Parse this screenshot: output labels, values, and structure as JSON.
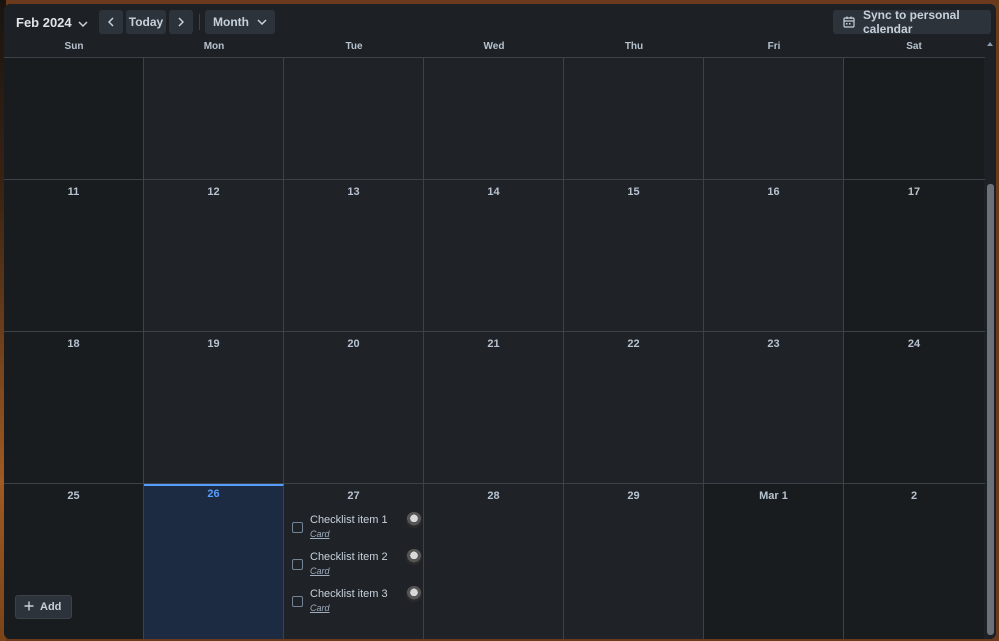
{
  "toolbar": {
    "month_label": "Feb 2024",
    "today_label": "Today",
    "view_label": "Month",
    "sync_label": "Sync to personal calendar"
  },
  "weekdays": [
    "Sun",
    "Mon",
    "Tue",
    "Wed",
    "Thu",
    "Fri",
    "Sat"
  ],
  "weeks": [
    {
      "days": [
        "",
        "",
        "",
        "",
        "",
        "",
        ""
      ]
    },
    {
      "days": [
        "11",
        "12",
        "13",
        "14",
        "15",
        "16",
        "17"
      ]
    },
    {
      "days": [
        "18",
        "19",
        "20",
        "21",
        "22",
        "23",
        "24"
      ]
    },
    {
      "days": [
        "25",
        "26",
        "27",
        "28",
        "29",
        "Mar 1",
        "2"
      ]
    }
  ],
  "today_index": {
    "week": 3,
    "day": 1
  },
  "tasks": [
    {
      "title": "Checklist item 1",
      "card": "Card"
    },
    {
      "title": "Checklist item 2",
      "card": "Card"
    },
    {
      "title": "Checklist item 3",
      "card": "Card"
    }
  ],
  "add_label": "Add",
  "colors": {
    "today_accent": "#579dff",
    "background": "#1d2125"
  }
}
